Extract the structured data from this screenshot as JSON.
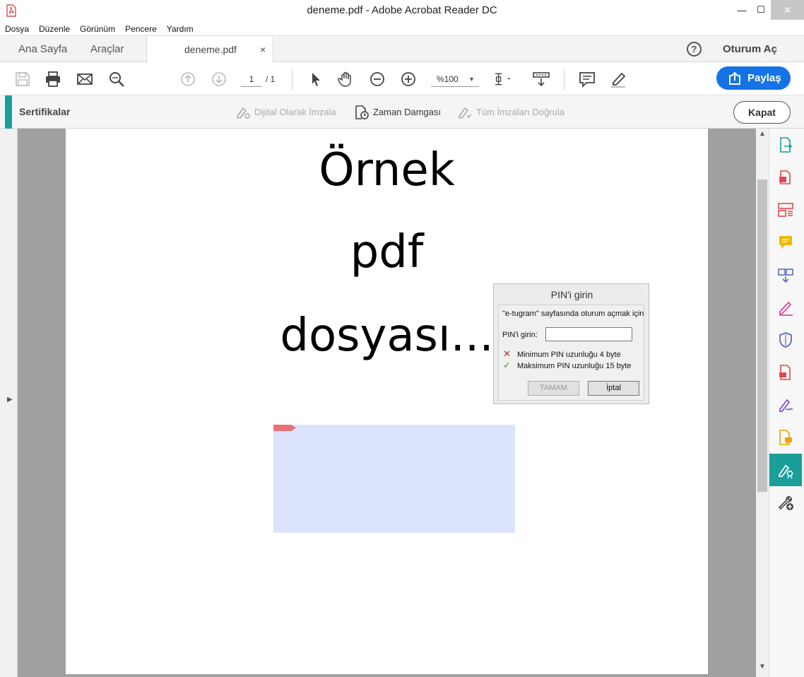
{
  "window": {
    "title": "deneme.pdf - Adobe Acrobat Reader DC",
    "controls": {
      "minimize": "—",
      "maximize": "☐",
      "close": "✕"
    }
  },
  "menu": [
    "Dosya",
    "Düzenle",
    "Görünüm",
    "Pencere",
    "Yardım"
  ],
  "tabs": {
    "home": "Ana Sayfa",
    "tools": "Araçlar",
    "document": "deneme.pdf",
    "close_glyph": "×"
  },
  "header": {
    "help": "?",
    "signin": "Oturum Aç"
  },
  "toolbar": {
    "page_current": "1",
    "page_total": "/ 1",
    "zoom": "%100",
    "share": "Paylaş"
  },
  "cert_bar": {
    "title": "Sertifikalar",
    "actions": [
      {
        "label": "Dijital Olarak İmzala",
        "enabled": false
      },
      {
        "label": "Zaman Damgası",
        "enabled": true
      },
      {
        "label": "Tüm İmzaları Doğrula",
        "enabled": false
      }
    ],
    "close": "Kapat"
  },
  "document": {
    "lines": [
      "Örnek",
      "pdf",
      "dosyası..."
    ]
  },
  "pin_dialog": {
    "title": "PIN'i girin",
    "message": "\"e-tugram\" sayfasında oturum açmak için",
    "pin_label": "PIN'i girin:",
    "pin_value": "",
    "rules": [
      {
        "text": "Minimum PIN uzunluğu 4 byte",
        "met": false
      },
      {
        "text": "Maksimum PIN uzunluğu 15 byte",
        "met": true
      }
    ],
    "ok": "TAMAM",
    "cancel": "İptal"
  },
  "colors": {
    "accent": "#1a9e99",
    "share": "#1473e6",
    "signature_field": "#dce3fc"
  }
}
